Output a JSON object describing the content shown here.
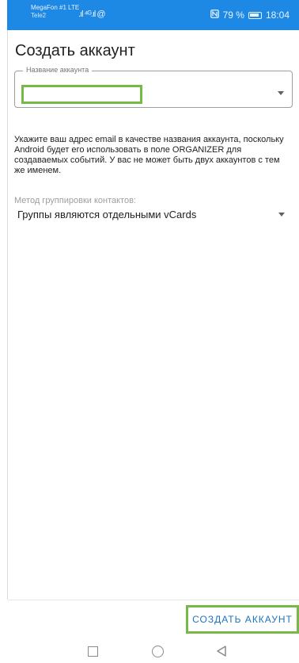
{
  "status_bar": {
    "carrier1": "MegaFon #1 LTE",
    "carrier2": "Tele2",
    "signal": ".ıl ⁴ᴳ.ıl @",
    "battery_pct": "79 %",
    "time": "18:04"
  },
  "page": {
    "title": "Создать аккаунт"
  },
  "account_name": {
    "label": "Название аккаунта",
    "value": ""
  },
  "help_text": "Укажите ваш адрес email в качестве названия аккаунта, поскольку Android будет его использовать в поле ORGANIZER для создаваемых событий. У вас не может быть двух аккаунтов с тем же именем.",
  "contact_group": {
    "label": "Метод группировки контактов:",
    "value": "Группы являются отдельными vCards"
  },
  "actions": {
    "create_label": "СОЗДАТЬ АККАУНТ"
  },
  "colors": {
    "status_bar": "#1e88e5",
    "accent_button_text": "#1e73be",
    "highlight_outline": "#76b947"
  }
}
